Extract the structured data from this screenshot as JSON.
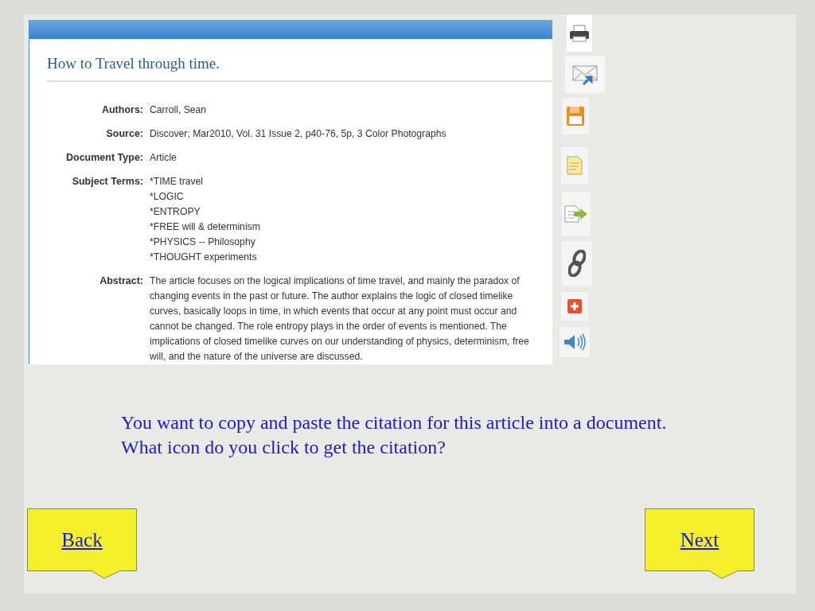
{
  "article": {
    "title": "How to Travel through time.",
    "fields": [
      {
        "label": "Authors:",
        "values": [
          "Carroll, Sean"
        ]
      },
      {
        "label": "Source:",
        "values": [
          "Discover; Mar2010, Vol. 31 Issue 2, p40-76, 5p, 3 Color Photographs"
        ]
      },
      {
        "label": "Document Type:",
        "values": [
          "Article"
        ]
      },
      {
        "label": "Subject Terms:",
        "values": [
          "*TIME travel",
          "*LOGIC",
          "*ENTROPY",
          "*FREE will & determinism",
          "*PHYSICS -- Philosophy",
          "*THOUGHT experiments"
        ]
      },
      {
        "label": "Abstract:",
        "values": [
          "The article focuses on the logical implications of time travel, and mainly the paradox of changing events in the past or future. The author explains the logic of closed timelike curves, basically loops in time, in which events that occur at any point must occur and cannot be changed. The role entropy plays in the order of events is mentioned. The implications of closed timelike curves on our understanding of physics, determinism, free will, and the nature of the universe are discussed."
        ]
      }
    ]
  },
  "question": "You want to copy and paste the citation for this article into a document.  What icon do you click to get the citation?",
  "nav": [
    {
      "label": "Back"
    },
    {
      "label": "Next"
    }
  ]
}
